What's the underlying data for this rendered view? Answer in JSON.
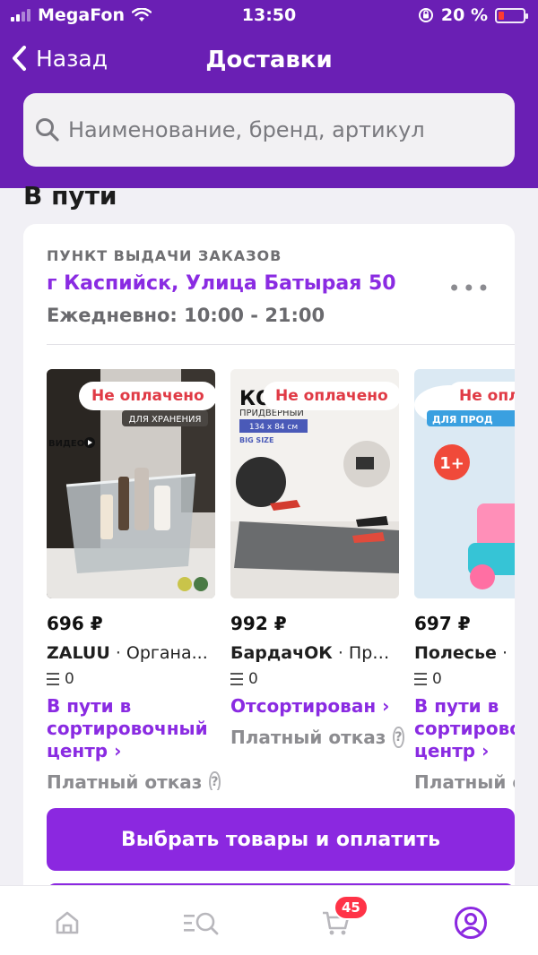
{
  "status_bar": {
    "carrier": "MegaFon",
    "time": "13:50",
    "battery": "20 %"
  },
  "nav": {
    "back_label": "Назад",
    "title": "Доставки"
  },
  "search": {
    "placeholder": "Наименование, бренд, артикул"
  },
  "section": {
    "title": "В пути"
  },
  "pickup": {
    "label": "ПУНКТ ВЫДАЧИ ЗАКАЗОВ",
    "address": "г Каспийск, Улица Батырая 50",
    "hours": "Ежедневно: 10:00 - 21:00",
    "more": "•••"
  },
  "products": [
    {
      "badge": "Не оплачено",
      "price": "696 ₽",
      "brand": "ZALUU",
      "title": "Органа...",
      "qty": "0",
      "status": "В пути в\nсортировочный\nцентр ›",
      "refusal": "Платный отказ",
      "image_text_top": "ДЛЯ ХРАНЕНИЯ",
      "image_text_video": "ВИДЕО"
    },
    {
      "badge": "Не оплачено",
      "price": "992 ₽",
      "brand": "БардачОК",
      "title": "При...",
      "qty": "0",
      "status": "Отсортирован ›",
      "refusal": "Платный отказ",
      "image_text_top": "ПРИДВЕРНЫЙ",
      "image_text_size": "134 x 84 см",
      "image_text_big": "BIG SIZE"
    },
    {
      "badge": "Не оплачено",
      "price": "697 ₽",
      "brand": "Полесье",
      "title": "",
      "qty": "0",
      "status": "В пути в\nсортировочный\nцентр ›",
      "refusal": "Платный отказ",
      "image_text_top": "ДЛЯ ПРОД",
      "image_text_age": "1+"
    }
  ],
  "actions": {
    "pay_button": "Выбрать товары и оплатить"
  },
  "tabbar": {
    "cart_count": "45"
  },
  "colors": {
    "brand": "#6a1fb4",
    "accent": "#8b28e0",
    "badge_red": "#e03a45"
  }
}
